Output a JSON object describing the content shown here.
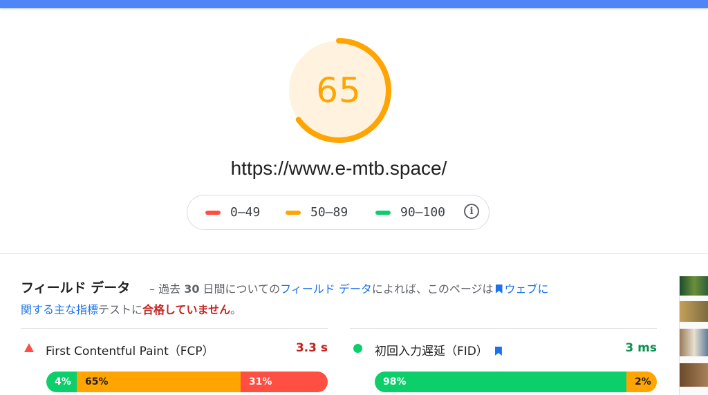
{
  "colors": {
    "fail": "#ff4e42",
    "average": "#ffa400",
    "pass": "#0cce6b",
    "link": "#1a73e8",
    "topbar": "#4f86f7"
  },
  "summary": {
    "score": "65",
    "score_fraction": 0.65,
    "url": "https://www.e-mtb.space/"
  },
  "legend": [
    {
      "label": "0–49",
      "color": "#ff4e42"
    },
    {
      "label": "50–89",
      "color": "#ffa400"
    },
    {
      "label": "90–100",
      "color": "#0cce6b"
    }
  ],
  "legend_info_icon": "info-icon",
  "field": {
    "title": "フィールド データ",
    "desc_prefix": "– 過去",
    "desc_days": "30",
    "desc_mid": "日間についての",
    "desc_link": "フィールド データ",
    "desc_mid2": "によれば、このページは",
    "desc_link2a": "ウェブに",
    "desc_link2b": "関する主な指標",
    "desc_mid3": "テストに",
    "desc_fail": "合格していません",
    "desc_end": "。"
  },
  "metrics": [
    {
      "name": "First Contentful Paint（FCP）",
      "value": "3.3 s",
      "status": "fail",
      "distribution": [
        {
          "label": "4%",
          "pct": 4,
          "color": "#0cce6b"
        },
        {
          "label": "65%",
          "pct": 65,
          "color": "#ffa400"
        },
        {
          "label": "31%",
          "pct": 31,
          "color": "#ff4e42"
        }
      ]
    },
    {
      "name": "初回入力遅延（FID）",
      "value": "3 ms",
      "status": "pass",
      "distribution": [
        {
          "label": "98%",
          "pct": 98,
          "color": "#0cce6b"
        },
        {
          "label": "2%",
          "pct": 2,
          "color": "#ffa400"
        }
      ]
    }
  ]
}
